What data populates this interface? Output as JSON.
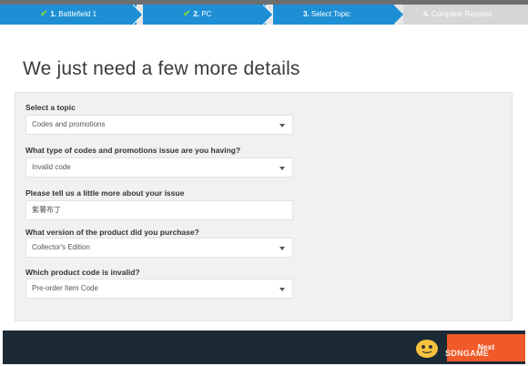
{
  "stepper": {
    "steps": [
      {
        "num": "1.",
        "label": "Battlefield 1",
        "state": "done"
      },
      {
        "num": "2.",
        "label": "PC",
        "state": "done"
      },
      {
        "num": "3.",
        "label": "Select Topic",
        "state": "active"
      },
      {
        "num": "4.",
        "label": "Complete Request",
        "state": "todo"
      }
    ],
    "check_glyph": "✔"
  },
  "page": {
    "title": "We just need a few more details"
  },
  "form": {
    "topic_label": "Select a topic",
    "topic_value": "Codes and promotions",
    "issue_type_label": "What type of codes and promotions issue are you having?",
    "issue_type_value": "Invalid code",
    "details_label": "Please tell us a little more about your issue",
    "details_value": "紫薯布丁",
    "version_label": "What version of the product did you purchase?",
    "version_value": "Collector's Edition",
    "code_label": "Which product code is invalid?",
    "code_value": "Pre-order Item Code"
  },
  "footer": {
    "next_label": "Next",
    "watermark": "SDNGAME"
  },
  "colors": {
    "stepper_blue": "#1e8fd5",
    "check_green": "#7cd34a",
    "next_orange": "#f05a28",
    "footer_navy": "#1c2a36"
  }
}
